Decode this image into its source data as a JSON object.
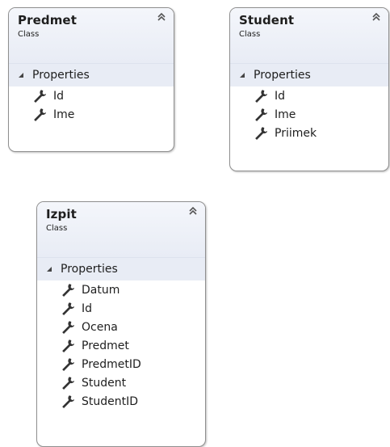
{
  "classes": [
    {
      "name": "Predmet",
      "kind": "Class",
      "section": "Properties",
      "properties": [
        "Id",
        "Ime"
      ]
    },
    {
      "name": "Student",
      "kind": "Class",
      "section": "Properties",
      "properties": [
        "Id",
        "Ime",
        "Priimek"
      ]
    },
    {
      "name": "Izpit",
      "kind": "Class",
      "section": "Properties",
      "properties": [
        "Datum",
        "Id",
        "Ocena",
        "Predmet",
        "PredmetID",
        "Student",
        "StudentID"
      ]
    }
  ],
  "icons": {
    "collapse": "double-chevron-up-icon",
    "section_toggle": "expanded-triangle-icon",
    "property": "wrench-icon"
  },
  "colors": {
    "header_background": "#e8ecf5",
    "border": "#8f8f8f",
    "text": "#1e1e1e"
  }
}
